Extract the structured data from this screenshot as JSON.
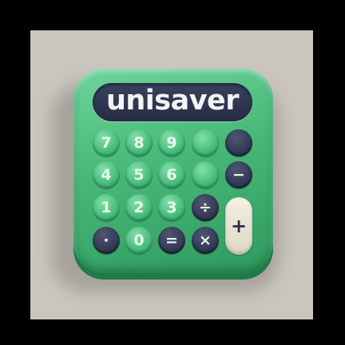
{
  "logo": {
    "text": "unisaver"
  },
  "keys": {
    "k7": "7",
    "k8": "8",
    "k9": "9",
    "k_blank": "",
    "k_top_dark": "",
    "k4": "4",
    "k5": "5",
    "k6": "6",
    "k_blank2": "",
    "minus": "−",
    "k1": "1",
    "k2": "2",
    "k3": "3",
    "divide": "÷",
    "plus": "+",
    "dot": "·",
    "k0": "0",
    "equals": "=",
    "multiply": "×"
  },
  "colors": {
    "body": "#47b878",
    "display": "#2d3350",
    "dark_key": "#343a55",
    "plus_key": "#ece7d5",
    "background": "#cac6bf"
  }
}
